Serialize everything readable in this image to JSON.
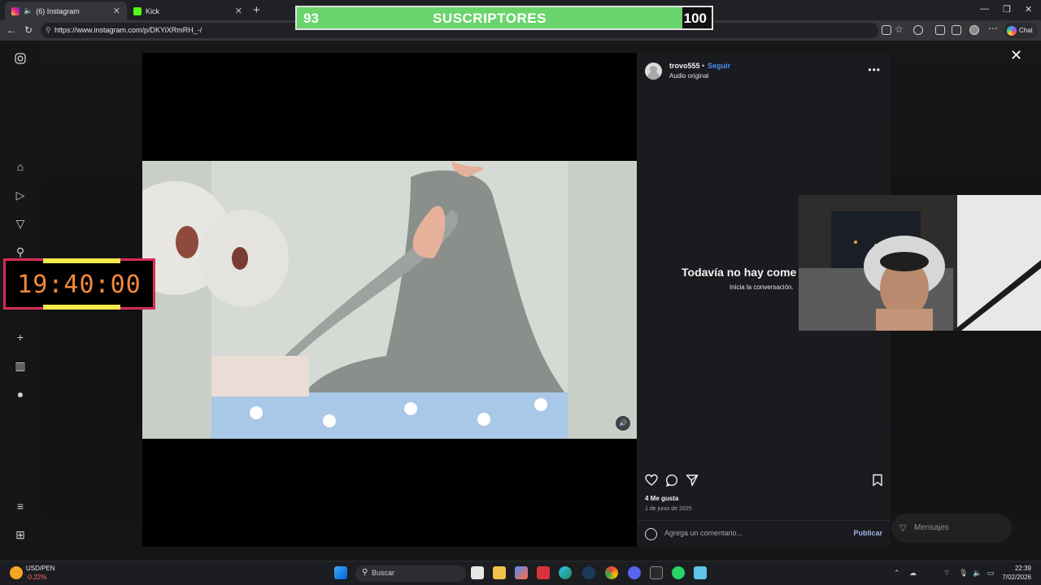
{
  "browser": {
    "tabs": [
      {
        "label": "(6) Instagram"
      },
      {
        "label": "Kick"
      }
    ],
    "url": "https://www.instagram.com/p/DKYiXRmRH_-/",
    "chat_label": "Chat"
  },
  "subscriber_goal": {
    "current": "93",
    "label": "SUSCRIPTORES",
    "target": "100",
    "progress": 0.93,
    "fill_color": "#69d46b"
  },
  "timer": {
    "value": "19:40:00",
    "color": "#f58a3b",
    "border_color": "#d62d58"
  },
  "post": {
    "username": "trovo555",
    "separator": "•",
    "follow_label": "Seguir",
    "audio": "Audio original",
    "more_icon": "more-icon",
    "empty_title": "Todavía no hay come",
    "empty_subtitle": "Inicia la conversación.",
    "likes": "4 Me gusta",
    "date": "1 de junio de 2025",
    "comment_placeholder": "Agrega un comentario...",
    "publish_label": "Publicar"
  },
  "background": {
    "messages_label": "Mensajes"
  },
  "taskbar": {
    "stock_name": "USD/PEN",
    "stock_change": "-0.22%",
    "search_placeholder": "Buscar",
    "time": "22:39",
    "date": "7/02/2026"
  },
  "accent": {
    "link": "#4d8cf5",
    "instagram_tab": "#dd2a7b",
    "kick_tab": "#53fc18"
  }
}
